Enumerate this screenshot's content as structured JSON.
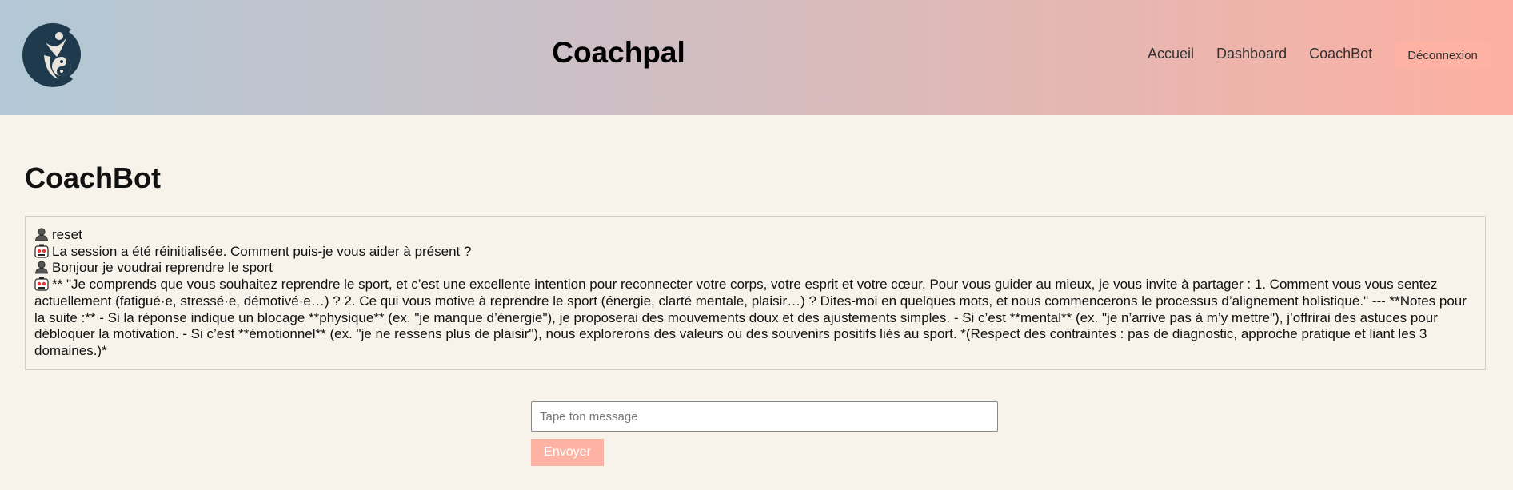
{
  "header": {
    "brand": "Coachpal",
    "nav": [
      {
        "label": "Accueil"
      },
      {
        "label": "Dashboard"
      },
      {
        "label": "CoachBot"
      }
    ],
    "logout_label": "Déconnexion"
  },
  "page": {
    "title": "CoachBot"
  },
  "chat": {
    "messages": [
      {
        "sender": "user",
        "icon": "user-avatar-icon",
        "text": "reset"
      },
      {
        "sender": "bot",
        "icon": "bot-avatar-icon",
        "text": "La session a été réinitialisée. Comment puis-je vous aider à présent ?"
      },
      {
        "sender": "user",
        "icon": "user-avatar-icon",
        "text": "Bonjour je voudrai reprendre le sport"
      },
      {
        "sender": "bot",
        "icon": "bot-avatar-icon",
        "text": "** \"Je comprends que vous souhaitez reprendre le sport, et c’est une excellente intention pour reconnecter votre corps, votre esprit et votre cœur. Pour vous guider au mieux, je vous invite à partager : 1. Comment vous vous sentez actuellement (fatigué·e, stressé·e, démotivé·e…) ? 2. Ce qui vous motive à reprendre le sport (énergie, clarté mentale, plaisir…) ? Dites-moi en quelques mots, et nous commencerons le processus d’alignement holistique.\" --- **Notes pour la suite :** - Si la réponse indique un blocage **physique** (ex. \"je manque d’énergie\"), je proposerai des mouvements doux et des ajustements simples. - Si c’est **mental** (ex. \"je n’arrive pas à m’y mettre\"), j’offrirai des astuces pour débloquer la motivation. - Si c’est **émotionnel** (ex. \"je ne ressens plus de plaisir\"), nous explorerons des valeurs ou des souvenirs positifs liés au sport. *(Respect des contraintes : pas de diagnostic, approche pratique et liant les 3 domaines.)*"
      }
    ]
  },
  "composer": {
    "placeholder": "Tape ton message",
    "send_label": "Envoyer"
  },
  "colors": {
    "accent": "#fdb2a4",
    "logo": "#1e3a4c",
    "background": "#f7f3ea"
  }
}
